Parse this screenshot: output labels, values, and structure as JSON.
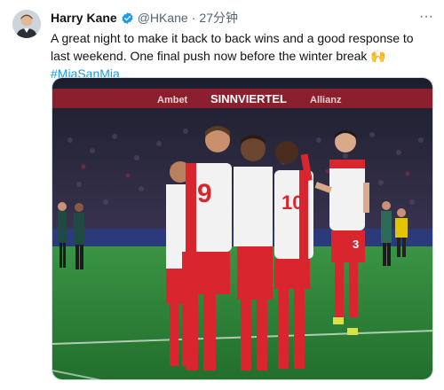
{
  "author": {
    "name": "Harry Kane",
    "handle": "@HKane",
    "separator": "·",
    "time": "27分钟",
    "verified_icon": "verified-badge-icon",
    "avatar_icon": "avatar"
  },
  "tweet": {
    "text": "A great night to make it back to back wins and a good response to last weekend. One final push now before the winter break",
    "emoji": "🙌",
    "hashtag": "#MiaSanMia"
  },
  "more_label": "···",
  "media": {
    "ad_boards": [
      "Ambet",
      "SINNVIERTEL",
      "Allianz"
    ],
    "shirt_numbers": [
      "9",
      "10",
      "3"
    ],
    "colors": {
      "pitch": "#2f8a3a",
      "jersey_red": "#d8252e",
      "jersey_white": "#f2f2f2",
      "stands": "#2a2f45",
      "verified": "#1d9bf0"
    }
  }
}
